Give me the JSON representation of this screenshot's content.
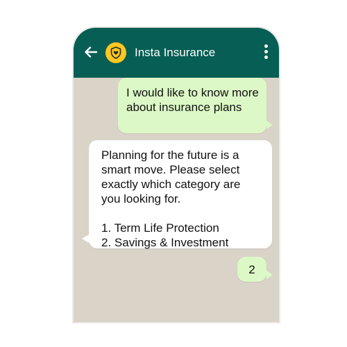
{
  "header": {
    "contact_name": "Insta Insurance",
    "avatar_icon": "shield-heart-icon",
    "back_icon": "back-arrow-icon",
    "menu_icon": "more-vertical-icon"
  },
  "colors": {
    "header": "#075e54",
    "chat_background": "#dad3c8",
    "outgoing_bubble": "#dcf8c6",
    "incoming_bubble": "#ffffff",
    "avatar": "#ffc81f"
  },
  "messages": [
    {
      "direction": "outgoing",
      "lines": [
        "I would like to know",
        "more about insurance",
        "plans"
      ]
    },
    {
      "direction": "incoming",
      "lines": [
        "Planning for the future is a",
        "smart move. Please select",
        "exactly which category are",
        "you looking for.",
        "",
        "1. Term Life Protection",
        "2. Savings & Investment"
      ]
    },
    {
      "direction": "outgoing",
      "lines": [
        "2"
      ]
    }
  ]
}
